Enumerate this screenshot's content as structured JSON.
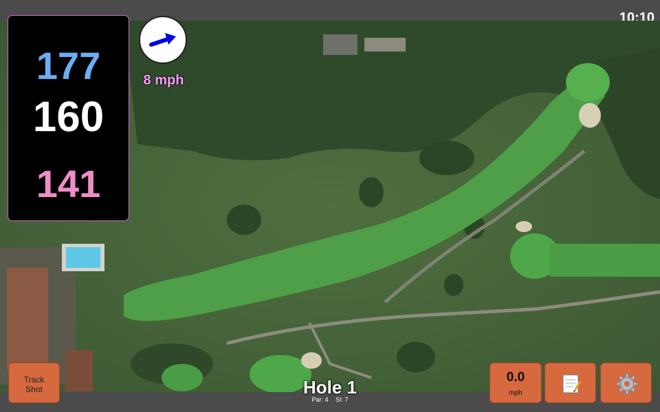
{
  "status": {
    "time": "10:10"
  },
  "distances": {
    "back": "177",
    "middle": "160",
    "front": "141"
  },
  "wind": {
    "speed_label": "8 mph",
    "icon": "wind-direction-arrow-icon"
  },
  "hole": {
    "title": "Hole 1",
    "par": "Par: 4",
    "stroke_index": "SI: 7"
  },
  "buttons": {
    "track_line1": "Track",
    "track_line2": "Shot",
    "speed_value": "0.0",
    "speed_unit": "mph",
    "notes_icon": "scorecard-notes-icon",
    "settings_icon": "settings-gear-icon"
  },
  "colors": {
    "back_distance": "#6aaef3",
    "middle_distance": "#ffffff",
    "front_distance": "#f08cc6",
    "button_bg": "#d6693e",
    "wind_label": "#ff9cff"
  }
}
